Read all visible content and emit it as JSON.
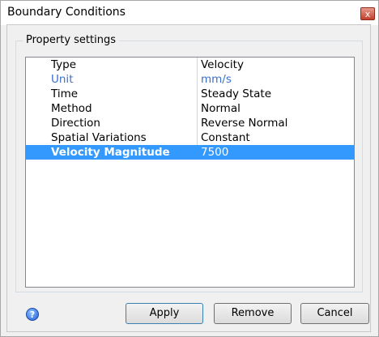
{
  "window": {
    "title": "Boundary Conditions",
    "close_glyph": "x"
  },
  "group": {
    "legend": "Property settings"
  },
  "properties": [
    {
      "name": "Type",
      "value": "Velocity"
    },
    {
      "name": "Unit",
      "value": "mm/s"
    },
    {
      "name": "Time",
      "value": "Steady State"
    },
    {
      "name": "Method",
      "value": "Normal"
    },
    {
      "name": "Direction",
      "value": "Reverse Normal"
    },
    {
      "name": "Spatial Variations",
      "value": "Constant"
    },
    {
      "name": "Velocity Magnitude",
      "value": "7500"
    }
  ],
  "selected_property": "Velocity Magnitude",
  "footer": {
    "help_icon": "question-circle-icon",
    "help_glyph": "?",
    "apply_label": "Apply",
    "remove_label": "Remove",
    "cancel_label": "Cancel"
  },
  "colors": {
    "selection": "#3399ff",
    "unit_text": "#3b6fc7"
  }
}
